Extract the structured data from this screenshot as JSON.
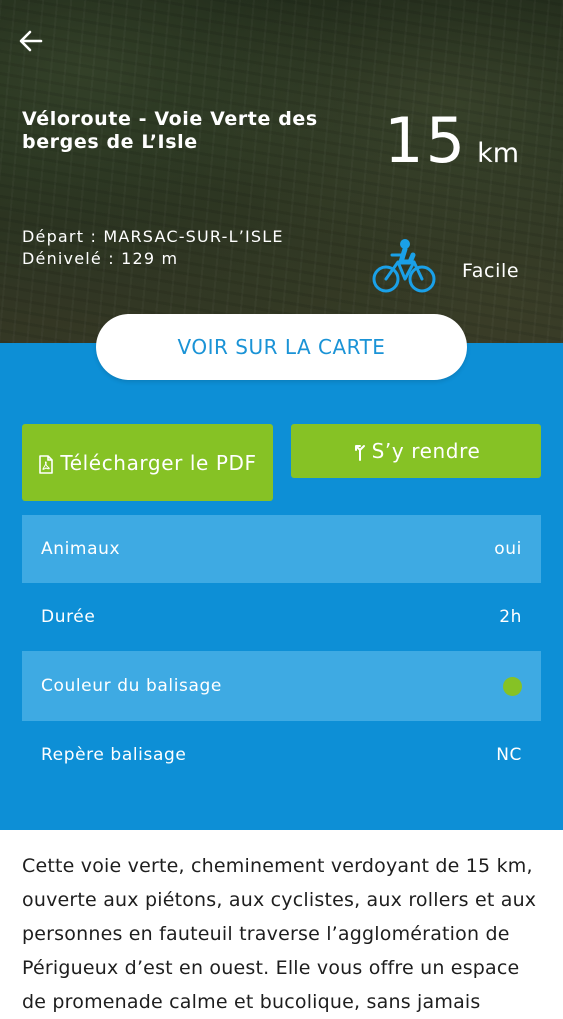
{
  "header": {
    "back_icon": "arrow-left-icon",
    "title": "Véloroute - Voie Verte des berges de L’Isle",
    "distance_value": "15",
    "distance_unit": "km",
    "depart": "Départ : MARSAC-SUR-L’ISLE",
    "denivele": "Dénivelé : 129 m",
    "activity_icon": "bicycle-icon",
    "difficulty": "Facile"
  },
  "actions": {
    "map_button": "VOIR SUR LA CARTE",
    "pdf_button": "Télécharger le PDF",
    "pdf_icon": "pdf-file-icon",
    "directions_button": "S’y rendre",
    "directions_icon": "directions-icon"
  },
  "details": [
    {
      "label": "Animaux",
      "value": "oui"
    },
    {
      "label": "Durée",
      "value": "2h"
    },
    {
      "label": "Couleur du balisage",
      "value": "",
      "color": "#86c225"
    },
    {
      "label": "Repère balisage",
      "value": "NC"
    }
  ],
  "description": "Cette voie verte, cheminement verdoyant de 15 km, ouverte aux piétons, aux cyclistes, aux rollers et aux personnes en fauteuil traverse l’agglomération de Périgueux d’est en ouest. Elle vous offre un espace de promenade calme et bucolique, sans jamais",
  "colors": {
    "blue": "#0d8fd6",
    "row_highlight": "#3eaae3",
    "green": "#86c225",
    "map_button_text": "#1a93d6"
  }
}
